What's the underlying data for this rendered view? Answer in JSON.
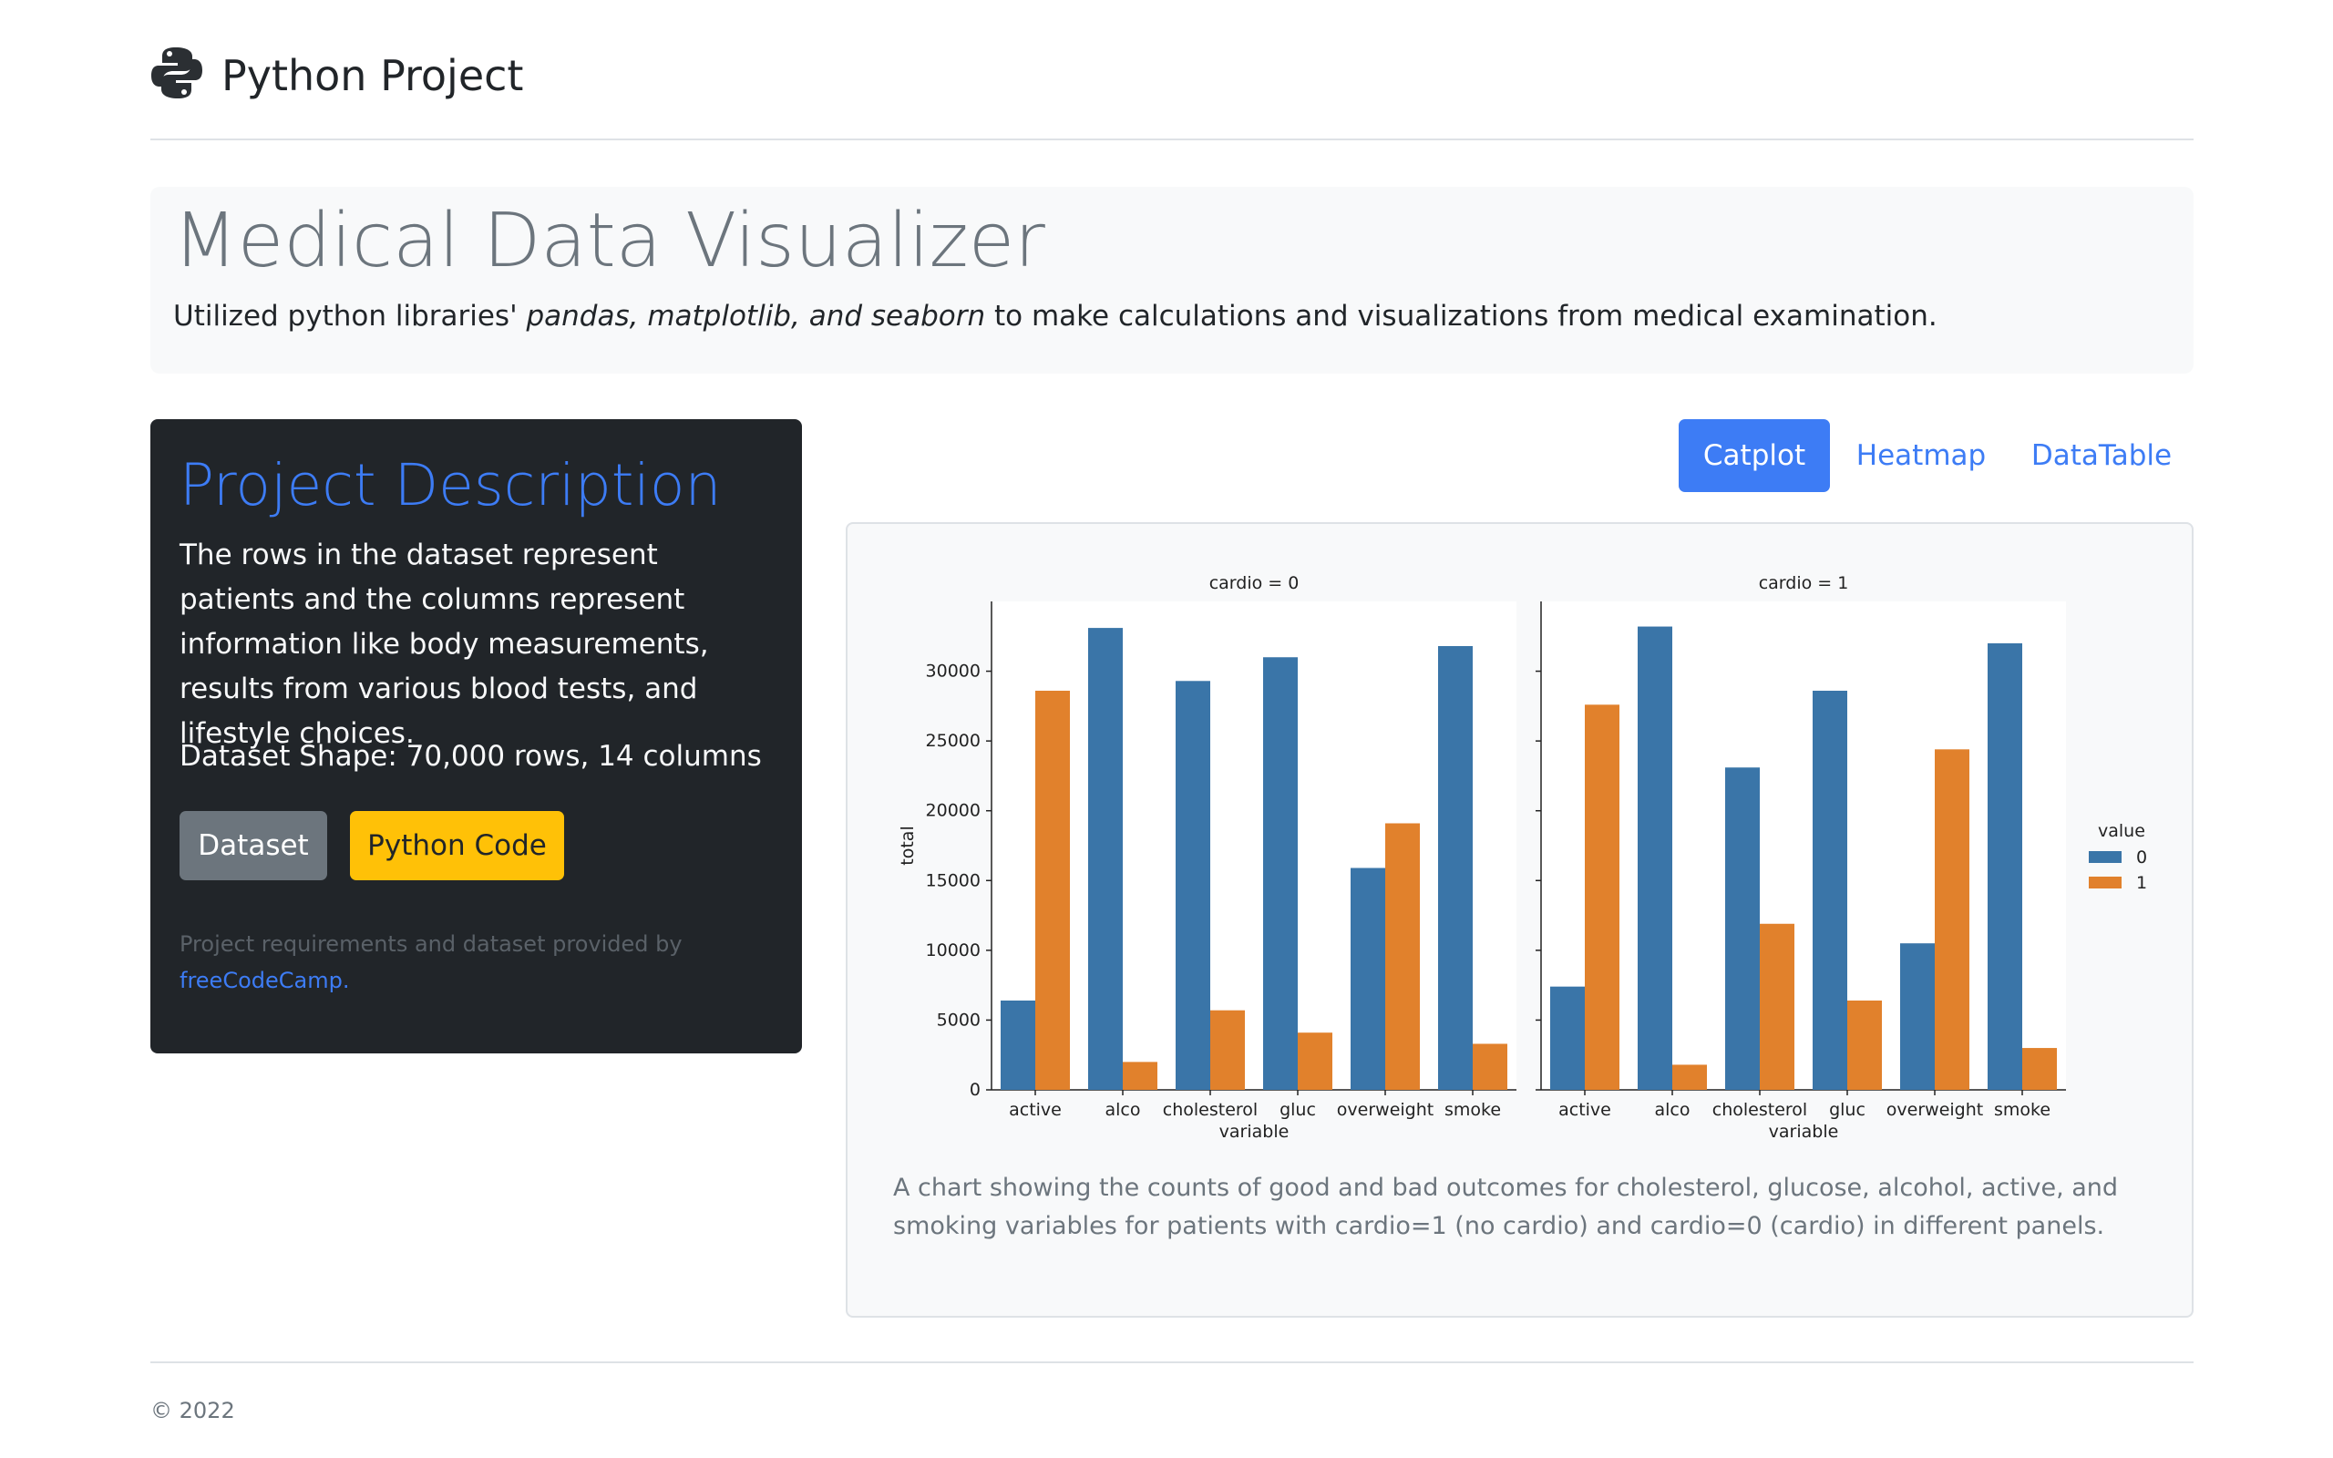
{
  "header": {
    "brand": "Python Project",
    "logo_icon": "python-logo-icon"
  },
  "jumbotron": {
    "title": "Medical Data Visualizer",
    "lead_prefix": "Utilized python libraries' ",
    "lead_em": "pandas, matplotlib, and seaborn",
    "lead_suffix": " to make calculations and visualizations from medical examination."
  },
  "card": {
    "title": "Project Description",
    "description": "The rows in the dataset represent patients and the columns represent information like body measurements, results from various blood tests, and lifestyle choices.",
    "shape": "Dataset Shape: 70,000 rows, 14 columns",
    "dataset_button": "Dataset",
    "code_button": "Python Code",
    "footer_text": "Project requirements and dataset provided by",
    "footer_link": "freeCodeCamp."
  },
  "tabs": {
    "catplot": "Catplot",
    "heatmap": "Heatmap",
    "datatable": "DataTable"
  },
  "caption": "A chart showing the counts of good and bad outcomes for cholesterol, glucose, alcohol, active, and smoking variables for patients with cardio=1 (no cardio) and cardio=0 (cardio) in different panels.",
  "footer": {
    "copyright": "© 2022"
  },
  "chart_data": {
    "type": "bar",
    "ylabel": "total",
    "xlabel": "variable",
    "ylim": [
      0,
      35000
    ],
    "yticks": [
      0,
      5000,
      10000,
      15000,
      20000,
      25000,
      30000
    ],
    "categories": [
      "active",
      "alco",
      "cholesterol",
      "gluc",
      "overweight",
      "smoke"
    ],
    "legend": {
      "title": "value",
      "position": "right",
      "entries": [
        "0",
        "1"
      ]
    },
    "colors": [
      "#3a75a8",
      "#e1812c"
    ],
    "panels": [
      {
        "title": "cardio = 0",
        "series": [
          {
            "name": "0",
            "values": [
              6400,
              33100,
              29300,
              31000,
              15900,
              31800
            ]
          },
          {
            "name": "1",
            "values": [
              28600,
              2000,
              5700,
              4100,
              19100,
              3300
            ]
          }
        ]
      },
      {
        "title": "cardio = 1",
        "series": [
          {
            "name": "0",
            "values": [
              7400,
              33200,
              23100,
              28600,
              10500,
              32000
            ]
          },
          {
            "name": "1",
            "values": [
              27600,
              1800,
              11900,
              6400,
              24400,
              3000
            ]
          }
        ]
      }
    ]
  }
}
